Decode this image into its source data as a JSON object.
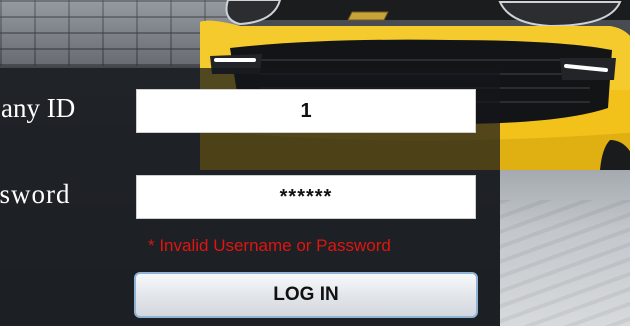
{
  "login": {
    "company_id_label": "npany ID",
    "company_id_value": "1",
    "password_label": "ssword",
    "password_value": "******",
    "error_message": "* Invalid Username or Password",
    "login_button_label": "LOG IN"
  },
  "colors": {
    "car_yellow": "#f2c21b",
    "error_red": "#e0150f",
    "panel_overlay": "#14161a",
    "button_border": "#8fb4d6"
  }
}
